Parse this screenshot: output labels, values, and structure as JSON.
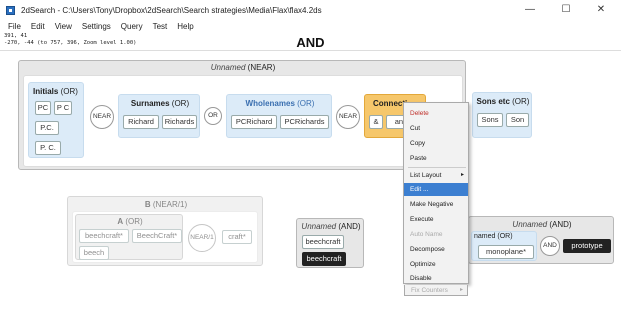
{
  "window": {
    "title": "2dSearch - C:\\Users\\Tony\\Dropbox\\2dSearch\\Search strategies\\Media\\Flax\\flax4.2ds",
    "minimize": "—",
    "maximize": "☐",
    "close": "✕"
  },
  "menu": [
    "File",
    "Edit",
    "View",
    "Settings",
    "Query",
    "Test",
    "Help"
  ],
  "status": {
    "line1": "391, 41",
    "line2": "-270, -44  (to 757, 396, Zoom level 1.00)",
    "top_operator": "AND"
  },
  "canvas": {
    "near_box": {
      "title_italic": "Unnamed",
      "title_op": "(NEAR)",
      "initials": {
        "label": "Initials",
        "op": "(OR)",
        "terms": [
          "PC",
          "P C",
          "P.C.",
          "P. C."
        ]
      },
      "op1": "NEAR",
      "surnames": {
        "label": "Surnames",
        "op": "(OR)",
        "terms": [
          "Richard",
          "Richards"
        ]
      },
      "op2": "OR",
      "wholenames": {
        "label": "Wholenames",
        "op": "(OR)",
        "terms": [
          "PCRichard",
          "PCRichards"
        ]
      },
      "op3": "NEAR",
      "connectives": {
        "label": "Connecti",
        "terms": [
          "&",
          "and"
        ]
      },
      "sons": {
        "label": "Sons etc",
        "op": "(OR)",
        "terms": [
          "Sons",
          "Son"
        ]
      }
    },
    "b_box": {
      "title": "B",
      "title_op": "(NEAR/1)",
      "a_label": "A",
      "a_op": "(OR)",
      "terms": [
        "beechcraft*",
        "BeechCraft*",
        "beech"
      ],
      "op": "NEAR/1",
      "extra": "craft*"
    },
    "mid_box": {
      "title_italic": "Unnamed",
      "title_op": "(AND)",
      "terms": [
        "beechcraft",
        "beechcraft"
      ]
    },
    "right_box": {
      "title_italic": "Unnamed",
      "title_op": "(AND)",
      "inner_italic": "named",
      "inner_op": "(OR)",
      "terms": [
        "monoplane*"
      ],
      "op": "AND",
      "dark_term": "prototype"
    }
  },
  "context_menu": {
    "items": [
      "Delete",
      "Cut",
      "Copy",
      "Paste",
      "List Layout",
      "Edit ...",
      "Make Negative",
      "Execute",
      "Auto Name",
      "Decompose",
      "Optimize",
      "Disable",
      "Fix Counters"
    ]
  },
  "colors": {
    "accent": "#3c7fd1",
    "delete": "#c0302b",
    "blue_group": "#dcebf8",
    "highlight": "#f6c76b"
  }
}
